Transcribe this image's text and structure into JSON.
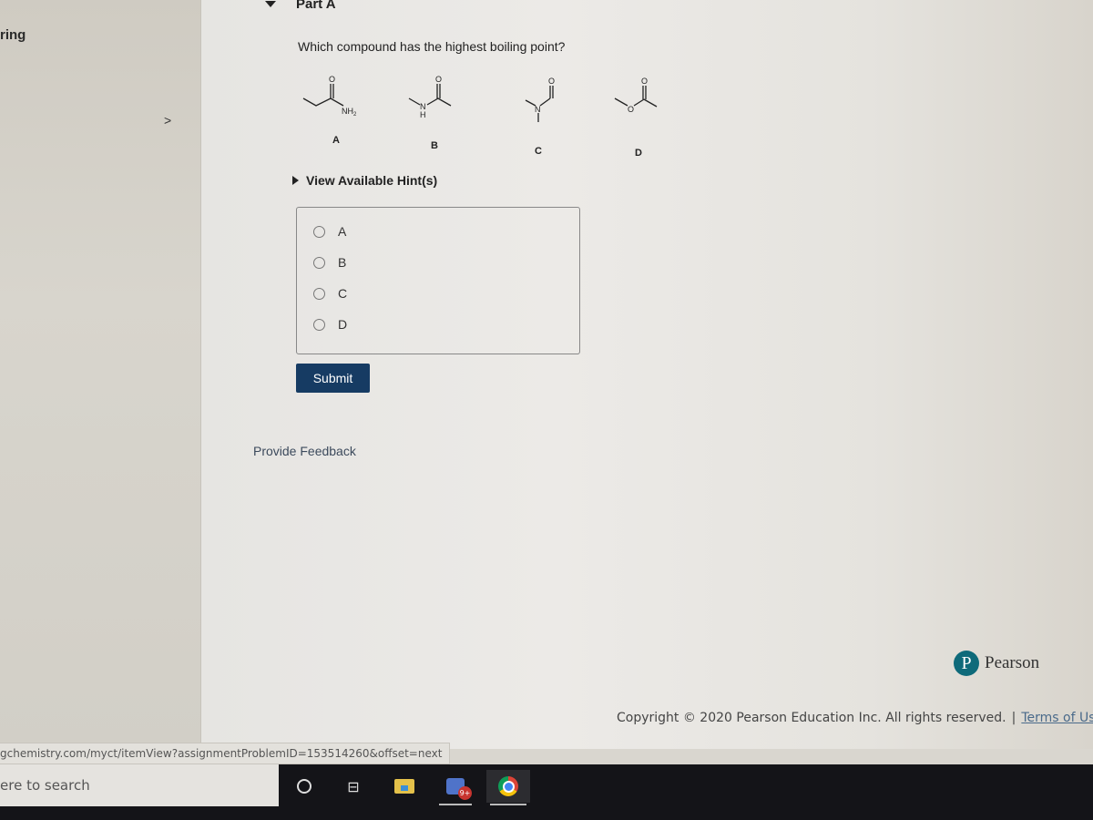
{
  "sidebar": {
    "title_fragment": "ring",
    "chevron": ">"
  },
  "part": {
    "title": "Part A",
    "question": "Which compound has the highest boiling point?",
    "structures": [
      {
        "label": "A",
        "name": "propanamide",
        "atoms": [
          "O",
          "NH2"
        ]
      },
      {
        "label": "B",
        "name": "N-methylacetamide",
        "atoms": [
          "O",
          "N",
          "H"
        ]
      },
      {
        "label": "C",
        "name": "N,N-dimethylformamide",
        "atoms": [
          "O",
          "N"
        ]
      },
      {
        "label": "D",
        "name": "methyl acetate",
        "atoms": [
          "O",
          "O"
        ]
      }
    ],
    "hint_label": "View Available Hint(s)",
    "choices": [
      "A",
      "B",
      "C",
      "D"
    ],
    "selected_choice": null,
    "submit_label": "Submit",
    "feedback_label": "Provide Feedback"
  },
  "footer": {
    "brand": "Pearson",
    "brand_logo_letter": "P",
    "copyright": "Copyright © 2020 Pearson Education Inc. All rights reserved.",
    "separator": "|",
    "terms_label": "Terms of Us"
  },
  "status_url": "gchemistry.com/myct/itemView?assignmentProblemID=153514260&offset=next",
  "taskbar": {
    "search_placeholder": "ere to search",
    "badge": "9+"
  },
  "colors": {
    "submit_bg": "#163b63",
    "pearson_teal": "#0e6a7a",
    "link": "#4a6a8a"
  }
}
